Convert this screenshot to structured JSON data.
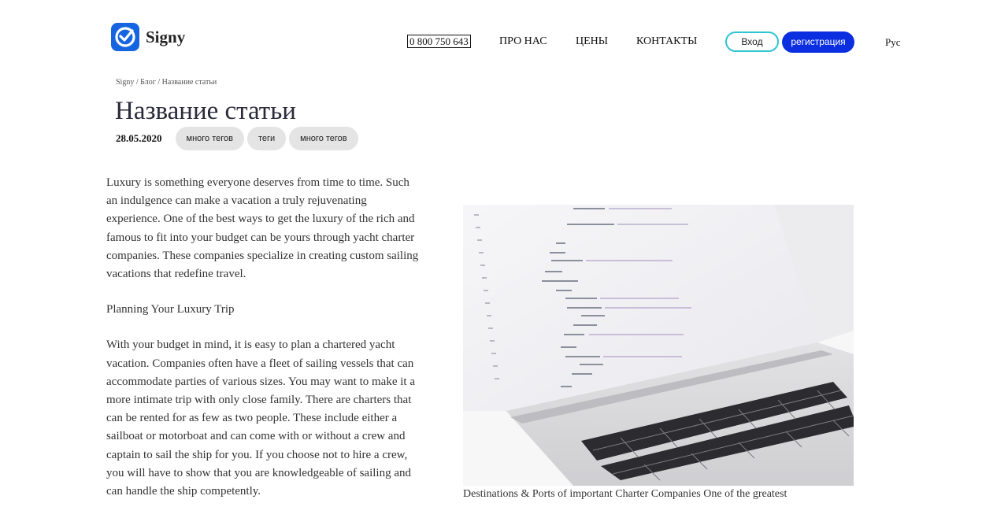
{
  "brand": {
    "name": "Signy"
  },
  "nav": {
    "phone": "0 800 750 643",
    "links": [
      "ПРО НАС",
      "ЦЕНЫ",
      "КОНТАКТЫ"
    ],
    "login": "Вход",
    "register": "регистрация",
    "language": "Рус"
  },
  "breadcrumb": "Signy / Блог / Название статьи",
  "article": {
    "title": "Название статьи",
    "date": "28.05.2020",
    "tags": [
      "много тегов",
      "теги",
      "много тегов"
    ],
    "paragraphs": [
      "Luxury is something everyone deserves from time to time. Such an indulgence can make a vacation a truly rejuvenating experience. One of the best ways to get the luxury of the rich and famous to fit into your budget can be yours through yacht charter companies. These companies specialize in creating custom sailing vacations that redefine travel.",
      "Planning Your Luxury Trip",
      "With your budget in mind, it is easy to plan a chartered yacht vacation. Companies often have a fleet of sailing vessels that can accommodate parties of various sizes. You may want to make it a more intimate trip with only close family. There are charters that can be rented for as few as two people. These include either a sailboat or motorboat and can come with or without a crew and captain to sail the ship for you. If you choose not to hire a crew, you will have to show that you are knowledgeable of sailing and can handle the ship competently."
    ],
    "caption": "Destinations & Ports of important Charter Companies One of the greatest"
  },
  "colors": {
    "accent": "#0a2ee0",
    "login_border": "#2ec4d6",
    "logo": "#1565e0",
    "tag_bg": "#e4e4e4"
  }
}
